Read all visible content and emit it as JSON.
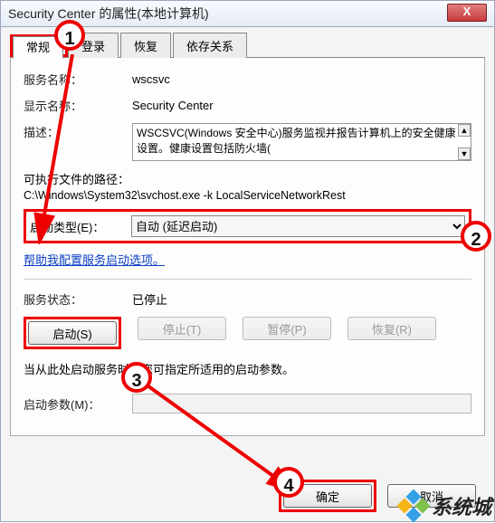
{
  "window": {
    "title": "Security Center 的属性(本地计算机)",
    "close_glyph": "X"
  },
  "tabs": {
    "general": "常规",
    "logon": "登录",
    "recovery": "恢复",
    "dependencies": "依存关系"
  },
  "labels": {
    "service_name": "服务名称：",
    "display_name": "显示名称：",
    "description": "描述：",
    "exe_path_label": "可执行文件的路径：",
    "startup_type": "启动类型(E)：",
    "service_status_label": "服务状态：",
    "help_text": "当从此处启动服务时，您可指定所适用的启动参数。",
    "start_params": "启动参数(M)："
  },
  "values": {
    "service_name": "wscsvc",
    "display_name": "Security Center",
    "description": "WSCSVC(Windows 安全中心)服务监视并报告计算机上的安全健康设置。健康设置包括防火墙(",
    "exe_path": "C:\\Windows\\System32\\svchost.exe -k LocalServiceNetworkRest",
    "startup_selected": "自动 (延迟启动)",
    "service_status": "已停止",
    "start_params": ""
  },
  "link": {
    "help_config": "帮助我配置服务启动选项。"
  },
  "buttons": {
    "start": "启动(S)",
    "stop": "停止(T)",
    "pause": "暂停(P)",
    "resume": "恢复(R)",
    "ok": "确定",
    "cancel": "取消"
  },
  "annotations": {
    "n1": "1",
    "n2": "2",
    "n3": "3",
    "n4": "4"
  },
  "watermark": "系统城"
}
